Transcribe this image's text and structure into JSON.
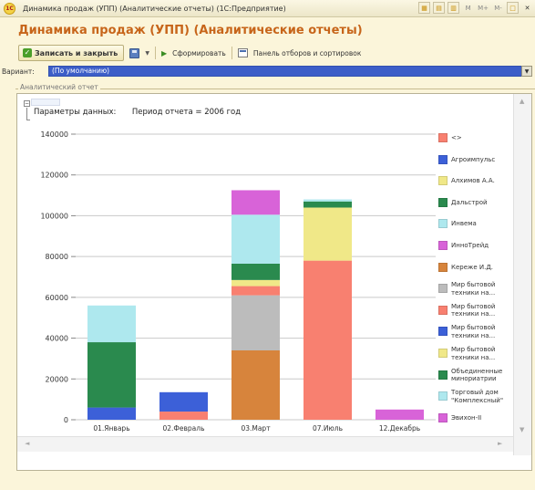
{
  "window": {
    "title": "Динамика продаж (УПП) (Аналитические отчеты)  (1С:Предприятие)",
    "logo": "1С",
    "buttons": [
      "M",
      "M+",
      "M-"
    ]
  },
  "form": {
    "heading": "Динамика продаж (УПП) (Аналитические отчеты)",
    "toolbar": {
      "save_close": "Записать и закрыть",
      "generate": "Сформировать",
      "filters": "Панель отборов и сортировок"
    },
    "variant": {
      "label": "Вариант:",
      "value": "(По умолчанию)"
    },
    "group_label": "Аналитический отчет",
    "params_label": "Параметры данных:",
    "params_value": "Период отчета = 2006 год"
  },
  "chart_data": {
    "type": "bar",
    "stacked": true,
    "title": "",
    "xlabel": "",
    "ylabel": "",
    "ylim": [
      0,
      140000
    ],
    "yticks": [
      0,
      20000,
      40000,
      60000,
      80000,
      100000,
      120000,
      140000
    ],
    "grid": true,
    "legend_position": "right",
    "categories": [
      "01.Январь",
      "02.Февраль",
      "03.Март",
      "07.Июль",
      "12.Декабрь"
    ],
    "series": [
      {
        "name": "<>",
        "color": "#f88070",
        "values": [
          0,
          0,
          0,
          0,
          0
        ]
      },
      {
        "name": "Агроимпульс",
        "color": "#3c60d8",
        "values": [
          0,
          0,
          0,
          0,
          0
        ]
      },
      {
        "name": "Алхимов А.А.",
        "color": "#f0e888",
        "values": [
          0,
          0,
          0,
          0,
          0
        ]
      },
      {
        "name": "Дальстрой",
        "color": "#2a8a4e",
        "values": [
          0,
          0,
          0,
          0,
          0
        ]
      },
      {
        "name": "Инвема",
        "color": "#aee8ee",
        "values": [
          0,
          0,
          0,
          0,
          0
        ]
      },
      {
        "name": "ИнноТрейд",
        "color": "#d863d8",
        "values": [
          0,
          0,
          0,
          0,
          0
        ]
      },
      {
        "name": "Кереже И.Д.",
        "color": "#d7843c",
        "values": [
          0,
          0,
          34000,
          0,
          0
        ]
      },
      {
        "name": "Мир бытовой техники на...",
        "color": "#bcbcbc",
        "values": [
          0,
          0,
          27000,
          0,
          0
        ]
      },
      {
        "name": "Мир бытовой техники на...",
        "color": "#f88070",
        "values": [
          0,
          4000,
          4500,
          78000,
          0
        ]
      },
      {
        "name": "Мир бытовой техники на...",
        "color": "#3c60d8",
        "values": [
          6000,
          9500,
          0,
          0,
          0
        ]
      },
      {
        "name": "Мир бытовой техники на...",
        "color": "#f0e888",
        "values": [
          0,
          0,
          3000,
          26000,
          0
        ]
      },
      {
        "name": "Объединенные минориатрии",
        "color": "#2a8a4e",
        "values": [
          32000,
          0,
          8000,
          3000,
          0
        ]
      },
      {
        "name": "Торговый дом \"Комплексный\"",
        "color": "#aee8ee",
        "values": [
          18000,
          0,
          24000,
          1000,
          0
        ]
      },
      {
        "name": "Эвихон-II",
        "color": "#d863d8",
        "values": [
          0,
          0,
          12000,
          0,
          5000
        ]
      }
    ]
  },
  "colors": {
    "accent": "#c7651a",
    "variant_bg": "#3c5ec8",
    "window_bg": "#fbf5da"
  }
}
